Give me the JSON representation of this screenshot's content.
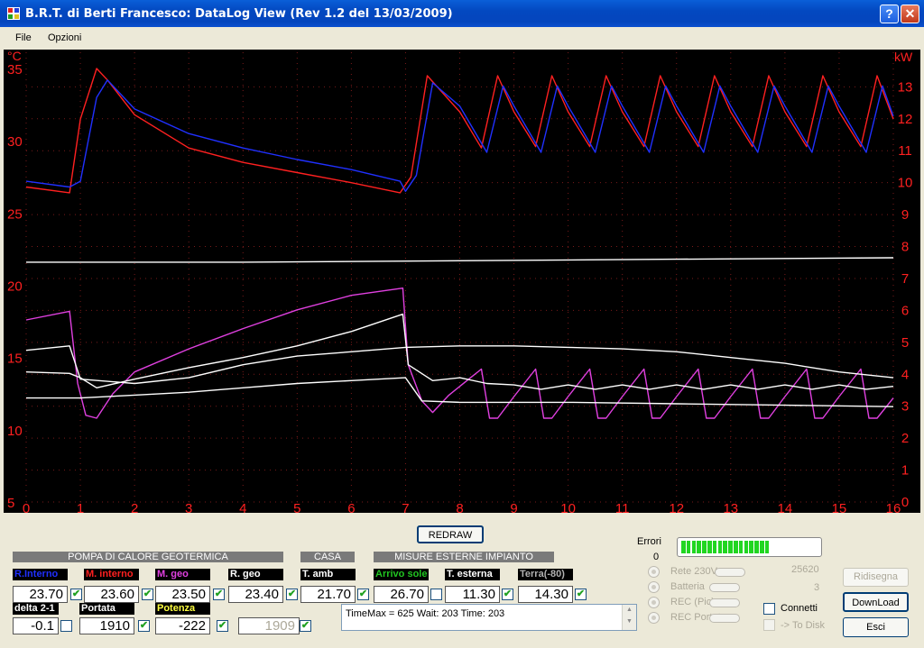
{
  "window": {
    "title": "B.R.T. di Berti Francesco: DataLog View  (Rev 1.2 del 13/03/2009)",
    "help_label": "?",
    "close_label": "✕"
  },
  "menu": {
    "file": "File",
    "options": "Opzioni"
  },
  "colors": {
    "red": "#ff2020",
    "blue": "#2030ff",
    "magenta": "#e040e0",
    "white": "#ffffff",
    "green": "#21c521",
    "yellow": "#ffff40",
    "gray": "#b0b0b0"
  },
  "chart_data": {
    "type": "line",
    "left_unit": "°C",
    "right_unit": "kW",
    "x_ticks": [
      "0",
      "1",
      "2",
      "3",
      "4",
      "5",
      "6",
      "7",
      "8",
      "9",
      "10",
      "11",
      "12",
      "13",
      "14",
      "15",
      "16"
    ],
    "left_ticks": [
      "5",
      "10",
      "15",
      "20",
      "25",
      "30",
      "35"
    ],
    "right_ticks": [
      "0",
      "1",
      "2",
      "3",
      "4",
      "5",
      "6",
      "7",
      "8",
      "9",
      "10",
      "11",
      "12",
      "13"
    ],
    "xlim": [
      0,
      16
    ],
    "ylim_left": [
      5,
      35.5
    ],
    "ylim_right": [
      0,
      13.8
    ],
    "grid": true,
    "series": [
      {
        "color": "red",
        "axis": "left",
        "points": [
          [
            0,
            26.8
          ],
          [
            0.8,
            26.4
          ],
          [
            1,
            31.5
          ],
          [
            1.3,
            35
          ],
          [
            1.5,
            34.2
          ],
          [
            2,
            31.8
          ],
          [
            3,
            29.5
          ],
          [
            4,
            28.5
          ],
          [
            5,
            27.8
          ],
          [
            6,
            27.1
          ],
          [
            6.9,
            26.4
          ],
          [
            7.1,
            27.5
          ],
          [
            7.4,
            34.5
          ],
          [
            8,
            32
          ],
          [
            8.4,
            29.5
          ],
          [
            8.7,
            34.5
          ],
          [
            9,
            32
          ],
          [
            9.4,
            29.6
          ],
          [
            9.7,
            34.5
          ],
          [
            10,
            32
          ],
          [
            10.4,
            29.6
          ],
          [
            10.7,
            34.5
          ],
          [
            11,
            32
          ],
          [
            11.4,
            29.6
          ],
          [
            11.7,
            34.5
          ],
          [
            12,
            32
          ],
          [
            12.4,
            29.6
          ],
          [
            12.7,
            34.5
          ],
          [
            13,
            32
          ],
          [
            13.4,
            29.6
          ],
          [
            13.7,
            34.5
          ],
          [
            14,
            32
          ],
          [
            14.4,
            29.6
          ],
          [
            14.7,
            34.5
          ],
          [
            15,
            32
          ],
          [
            15.4,
            29.6
          ],
          [
            15.7,
            34.5
          ],
          [
            16,
            31.5
          ]
        ]
      },
      {
        "color": "blue",
        "axis": "left",
        "points": [
          [
            0,
            27.2
          ],
          [
            0.8,
            26.8
          ],
          [
            1,
            27.2
          ],
          [
            1.3,
            33
          ],
          [
            1.5,
            34.2
          ],
          [
            2,
            32.2
          ],
          [
            3,
            30.5
          ],
          [
            4,
            29.5
          ],
          [
            5,
            28.7
          ],
          [
            6,
            28
          ],
          [
            6.9,
            27.2
          ],
          [
            7,
            26.5
          ],
          [
            7.2,
            27.6
          ],
          [
            7.5,
            34
          ],
          [
            8,
            32.4
          ],
          [
            8.5,
            29.2
          ],
          [
            8.8,
            33.8
          ],
          [
            9,
            32.4
          ],
          [
            9.5,
            29.2
          ],
          [
            9.8,
            33.8
          ],
          [
            10,
            32.4
          ],
          [
            10.5,
            29.2
          ],
          [
            10.8,
            33.8
          ],
          [
            11,
            32.4
          ],
          [
            11.5,
            29.2
          ],
          [
            11.8,
            33.8
          ],
          [
            12,
            32.4
          ],
          [
            12.5,
            29.2
          ],
          [
            12.8,
            33.8
          ],
          [
            13,
            32.4
          ],
          [
            13.5,
            29.2
          ],
          [
            13.8,
            33.8
          ],
          [
            14,
            32.4
          ],
          [
            14.5,
            29.2
          ],
          [
            14.8,
            33.8
          ],
          [
            15,
            32.4
          ],
          [
            15.5,
            29.2
          ],
          [
            15.8,
            33.8
          ],
          [
            16,
            31.7
          ]
        ]
      },
      {
        "color": "white",
        "axis": "left",
        "points": [
          [
            0,
            21.6
          ],
          [
            4,
            21.6
          ],
          [
            8,
            21.7
          ],
          [
            12,
            21.8
          ],
          [
            16,
            21.9
          ]
        ]
      },
      {
        "color": "magenta",
        "axis": "left",
        "points": [
          [
            0,
            17.6
          ],
          [
            0.8,
            18.2
          ],
          [
            0.95,
            13.2
          ],
          [
            1.1,
            11
          ],
          [
            1.3,
            10.8
          ],
          [
            1.6,
            12.5
          ],
          [
            2,
            14
          ],
          [
            3,
            15.6
          ],
          [
            4,
            17
          ],
          [
            5,
            18.3
          ],
          [
            6,
            19.3
          ],
          [
            6.95,
            19.8
          ],
          [
            7.05,
            14.5
          ],
          [
            7.3,
            12
          ],
          [
            7.5,
            11.2
          ],
          [
            7.8,
            12.4
          ],
          [
            8.2,
            13.6
          ],
          [
            8.4,
            14.2
          ],
          [
            8.55,
            10.8
          ],
          [
            8.7,
            10.8
          ],
          [
            9,
            12.3
          ],
          [
            9.4,
            14.2
          ],
          [
            9.55,
            10.8
          ],
          [
            9.7,
            10.8
          ],
          [
            10,
            12.3
          ],
          [
            10.4,
            14.2
          ],
          [
            10.55,
            10.8
          ],
          [
            10.7,
            10.8
          ],
          [
            11,
            12.3
          ],
          [
            11.4,
            14.2
          ],
          [
            11.55,
            10.8
          ],
          [
            11.7,
            10.8
          ],
          [
            12,
            12.3
          ],
          [
            12.4,
            14.2
          ],
          [
            12.55,
            10.8
          ],
          [
            12.7,
            10.8
          ],
          [
            13,
            12.3
          ],
          [
            13.4,
            14.2
          ],
          [
            13.55,
            10.8
          ],
          [
            13.7,
            10.8
          ],
          [
            14,
            12.3
          ],
          [
            14.4,
            14.2
          ],
          [
            14.55,
            10.8
          ],
          [
            14.7,
            10.8
          ],
          [
            15,
            12.3
          ],
          [
            15.4,
            14.2
          ],
          [
            15.55,
            10.8
          ],
          [
            15.7,
            10.8
          ],
          [
            16,
            12.2
          ]
        ]
      },
      {
        "color": "white",
        "axis": "left",
        "points": [
          [
            0,
            15.5
          ],
          [
            0.8,
            15.8
          ],
          [
            1,
            13.5
          ],
          [
            2,
            13.2
          ],
          [
            3,
            13.6
          ],
          [
            4,
            14.5
          ],
          [
            5,
            15.1
          ],
          [
            6,
            15.4
          ],
          [
            7,
            15.7
          ],
          [
            8,
            15.8
          ],
          [
            9,
            15.8
          ],
          [
            10,
            15.7
          ],
          [
            11,
            15.6
          ],
          [
            12,
            15.4
          ],
          [
            13,
            15
          ],
          [
            14,
            14.6
          ],
          [
            15,
            14
          ],
          [
            16,
            13.6
          ]
        ]
      },
      {
        "color": "white",
        "axis": "left",
        "points": [
          [
            0,
            14
          ],
          [
            0.8,
            13.9
          ],
          [
            1,
            13.6
          ],
          [
            1.3,
            12.9
          ],
          [
            2,
            13.5
          ],
          [
            3,
            14.3
          ],
          [
            4,
            15
          ],
          [
            5,
            15.8
          ],
          [
            6,
            16.8
          ],
          [
            6.95,
            18
          ],
          [
            7.05,
            14.5
          ],
          [
            7.5,
            13.4
          ],
          [
            8,
            13.6
          ],
          [
            8.5,
            13.2
          ],
          [
            9,
            13.1
          ],
          [
            9.5,
            12.8
          ],
          [
            10,
            13.1
          ],
          [
            10.5,
            12.8
          ],
          [
            11,
            13.1
          ],
          [
            11.5,
            12.8
          ],
          [
            12,
            13.1
          ],
          [
            12.5,
            12.8
          ],
          [
            13,
            13.1
          ],
          [
            13.5,
            12.8
          ],
          [
            14,
            13.1
          ],
          [
            14.5,
            12.8
          ],
          [
            15,
            13.1
          ],
          [
            15.5,
            12.8
          ],
          [
            16,
            13
          ]
        ]
      },
      {
        "color": "white",
        "axis": "left",
        "points": [
          [
            0,
            12.2
          ],
          [
            1,
            12.2
          ],
          [
            2,
            12.4
          ],
          [
            3,
            12.6
          ],
          [
            4,
            12.9
          ],
          [
            5,
            13.2
          ],
          [
            6,
            13.4
          ],
          [
            7,
            13.6
          ],
          [
            7.3,
            12
          ],
          [
            8,
            11.9
          ],
          [
            10,
            11.9
          ],
          [
            12,
            11.8
          ],
          [
            14,
            11.7
          ],
          [
            16,
            11.6
          ]
        ]
      }
    ]
  },
  "redraw": "REDRAW",
  "sections": {
    "pompa": "POMPA DI CALORE GEOTERMICA",
    "casa": "CASA",
    "misure": "MISURE ESTERNE IMPIANTO"
  },
  "fields": [
    {
      "key": "r-interno",
      "label": "R.Interno",
      "value": "23.70",
      "checked": true,
      "color": "blue"
    },
    {
      "key": "m-interno",
      "label": "M. interno",
      "value": "23.60",
      "checked": true,
      "color": "red"
    },
    {
      "key": "m-geo",
      "label": "M. geo",
      "value": "23.50",
      "checked": true,
      "color": "magenta"
    },
    {
      "key": "r-geo",
      "label": "R. geo",
      "value": "23.40",
      "checked": true,
      "color": "white"
    },
    {
      "key": "t-amb",
      "label": "T. amb",
      "value": "21.70",
      "checked": true,
      "color": "white"
    },
    {
      "key": "arrivo-sole",
      "label": "Arrivo sole",
      "value": "26.70",
      "checked": false,
      "color": "green"
    },
    {
      "key": "t-esterna",
      "label": "T. esterna",
      "value": "11.30",
      "checked": true,
      "color": "white"
    },
    {
      "key": "terra",
      "label": "Terra(-80)",
      "value": "14.30",
      "checked": true,
      "color": "gray"
    },
    {
      "key": "delta",
      "label": "delta 2-1",
      "value": "-0.1",
      "checked": false,
      "color": "white"
    },
    {
      "key": "portata",
      "label": "Portata",
      "value": "1910",
      "checked": true,
      "color": "white"
    },
    {
      "key": "potenza",
      "label": "Potenza",
      "value": "-222",
      "checked": true,
      "color": "yellow"
    },
    {
      "key": "extra",
      "label": "",
      "value": "1909",
      "checked": true,
      "color": "gray"
    }
  ],
  "log": {
    "text": "TimeMax = 625  Wait: 203  Time: 203"
  },
  "errors": {
    "label": "Errori",
    "value": "0"
  },
  "progress": {
    "segments_filled": 17,
    "segments_total": 26
  },
  "counters": {
    "value1": "25620",
    "value2": "3"
  },
  "status": [
    "Rete 230V",
    "Batteria",
    "REC (Pic)",
    "REC Portata"
  ],
  "options": {
    "connetti": "Connetti",
    "to_disk": "-> To Disk"
  },
  "buttons": {
    "ridisegna": "Ridisegna",
    "download": "DownLoad",
    "esci": "Esci"
  }
}
